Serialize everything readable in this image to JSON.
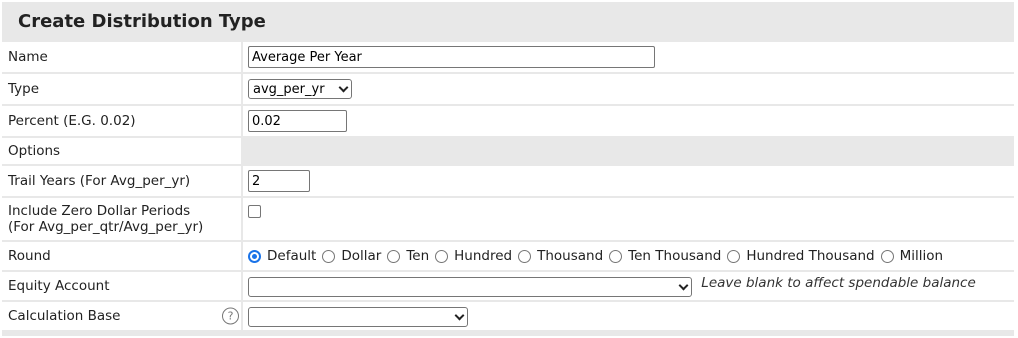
{
  "panel": {
    "title": "Create Distribution Type"
  },
  "fields": {
    "name": {
      "label": "Name",
      "value": "Average Per Year"
    },
    "type": {
      "label": "Type",
      "selected": "avg_per_yr"
    },
    "percent": {
      "label": "Percent (E.G. 0.02)",
      "value": "0.02"
    },
    "options": {
      "label": "Options"
    },
    "trail_years": {
      "label": "Trail Years (For Avg_per_yr)",
      "value": "2"
    },
    "include_zero": {
      "label_line1": "Include Zero Dollar Periods",
      "label_line2": "(For Avg_per_qtr/Avg_per_yr)",
      "checked": false
    },
    "round": {
      "label": "Round",
      "selected": "Default",
      "options": [
        "Default",
        "Dollar",
        "Ten",
        "Hundred",
        "Thousand",
        "Ten Thousand",
        "Hundred Thousand",
        "Million"
      ]
    },
    "equity_account": {
      "label": "Equity Account",
      "selected": "",
      "hint": "Leave blank to affect spendable balance"
    },
    "calculation_base": {
      "label": "Calculation Base",
      "selected": "",
      "help_icon": "question-circle-icon"
    }
  },
  "colors": {
    "panel_bg": "#e8e8e8",
    "radio_accent": "#1a73e8"
  }
}
